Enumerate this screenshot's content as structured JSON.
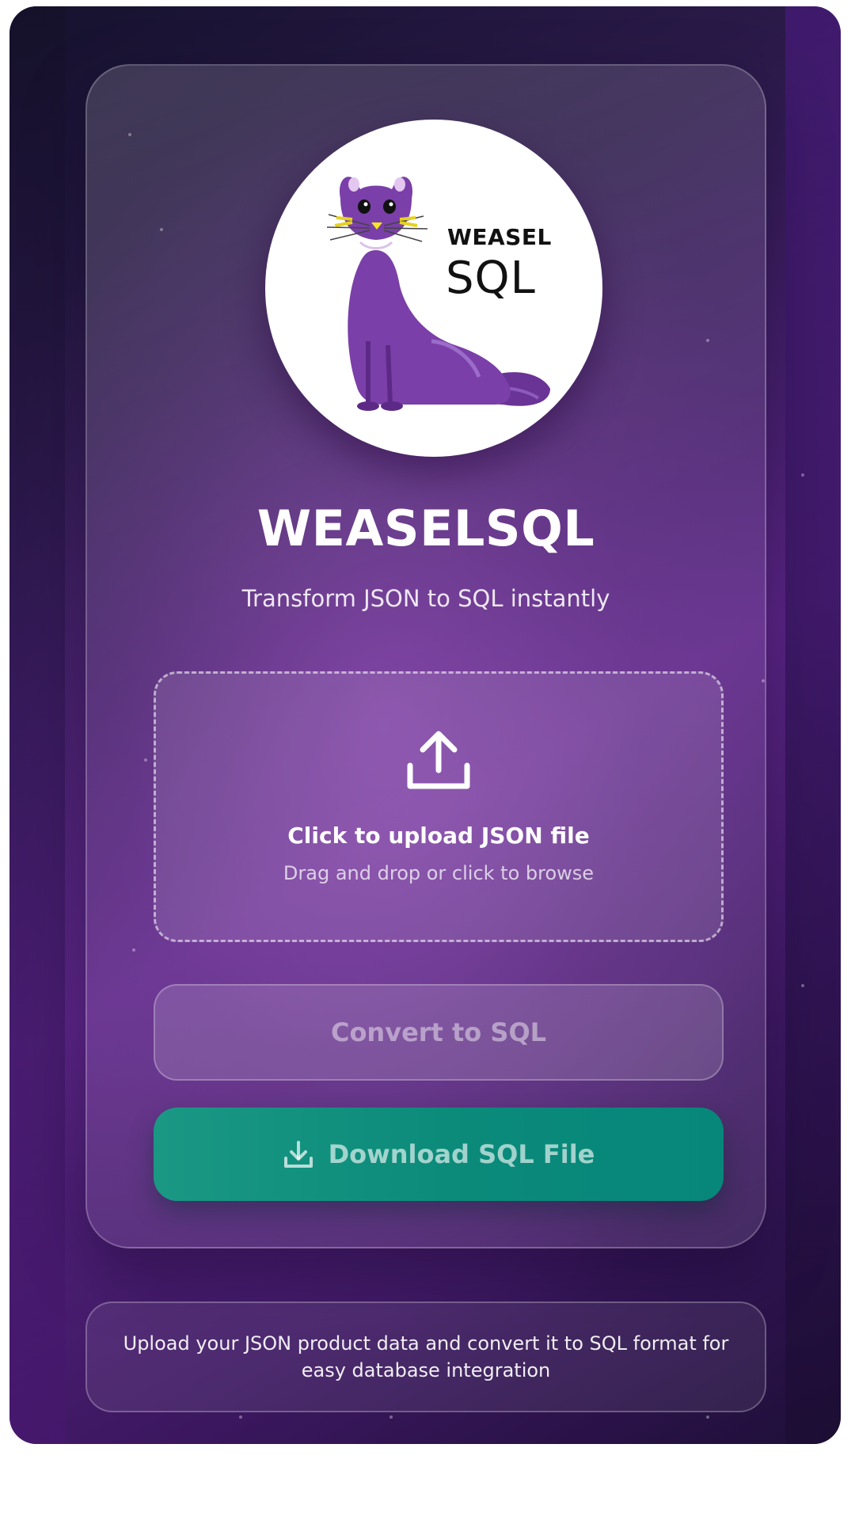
{
  "logo": {
    "wordmark_top": "WEASEL",
    "wordmark_bottom": "SQL",
    "mascot_icon": "weasel-mascot-icon"
  },
  "header": {
    "title": "WEASELSQL",
    "subtitle": "Transform JSON to SQL instantly"
  },
  "upload": {
    "icon": "upload-icon",
    "title": "Click to upload JSON file",
    "hint": "Drag and drop or click to browse"
  },
  "actions": {
    "convert_label": "Convert to SQL",
    "download_label": "Download SQL File",
    "download_icon": "download-icon"
  },
  "footer": {
    "info": "Upload your JSON product data and convert it to SQL format for easy database integration"
  },
  "colors": {
    "accent_teal": "#0b8a7a",
    "mascot_purple": "#7a3fa8",
    "background_purple": "#5a2485"
  }
}
